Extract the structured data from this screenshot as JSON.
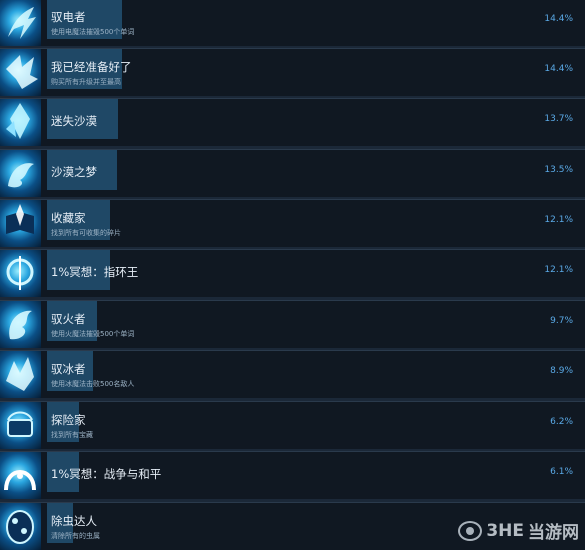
{
  "achievements": [
    {
      "name": "驭电者",
      "desc": "使用电魔法摧毁500个单词",
      "percent": "14.4%",
      "icon": "lightning-dragon-icon",
      "fill": 0.144
    },
    {
      "name": "我已经准备好了",
      "desc": "购买所有升级并至最高",
      "percent": "14.4%",
      "icon": "winged-creature-icon",
      "fill": 0.144
    },
    {
      "name": "迷失沙漠",
      "desc": "",
      "percent": "13.7%",
      "icon": "sand-crystal-icon",
      "fill": 0.137
    },
    {
      "name": "沙漠之梦",
      "desc": "",
      "percent": "13.5%",
      "icon": "dream-beast-icon",
      "fill": 0.135
    },
    {
      "name": "收藏家",
      "desc": "找到所有可收集的碎片",
      "percent": "12.1%",
      "icon": "open-book-icon",
      "fill": 0.121
    },
    {
      "name": "1%冥想：指环王",
      "desc": "",
      "percent": "12.1%",
      "icon": "ring-sigil-icon",
      "fill": 0.121
    },
    {
      "name": "驭火者",
      "desc": "使用火魔法摧毁500个单词",
      "percent": "9.7%",
      "icon": "fire-dragon-icon",
      "fill": 0.097
    },
    {
      "name": "驭冰者",
      "desc": "使用冰魔法击败500名敌人",
      "percent": "8.9%",
      "icon": "ice-dragon-icon",
      "fill": 0.089
    },
    {
      "name": "探险家",
      "desc": "找到所有宝藏",
      "percent": "6.2%",
      "icon": "treasure-chest-icon",
      "fill": 0.062
    },
    {
      "name": "1%冥想：战争与和平",
      "desc": "",
      "percent": "6.1%",
      "icon": "arch-portal-icon",
      "fill": 0.061
    },
    {
      "name": "除虫达人",
      "desc": "清除所有的虫属",
      "percent": "",
      "icon": "bug-egg-icon",
      "fill": 0.05
    }
  ],
  "watermark": {
    "text": "当游网",
    "logo_text": "3HE"
  }
}
